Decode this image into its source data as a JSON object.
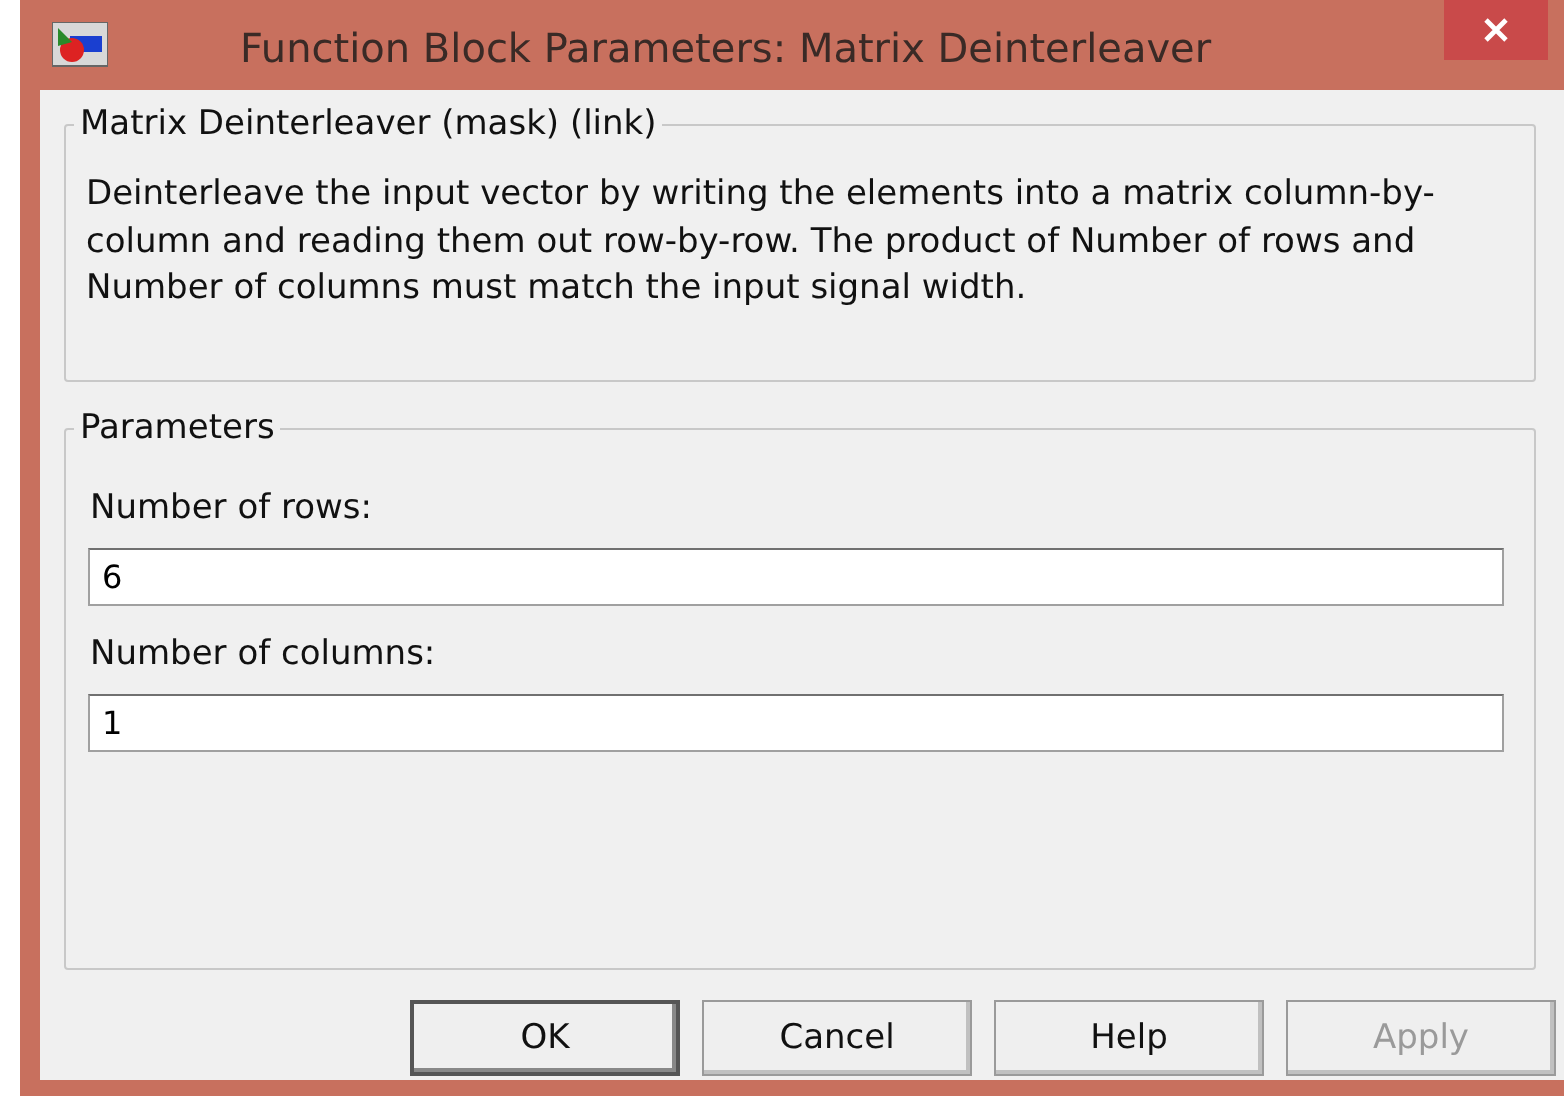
{
  "window": {
    "title": "Function Block Parameters: Matrix Deinterleaver"
  },
  "description_group": {
    "title": "Matrix Deinterleaver (mask) (link)",
    "text": "Deinterleave the input vector by writing the elements into a matrix column-by-column and reading them out row-by-row.  The product of Number of rows and Number of columns must match the input signal width."
  },
  "parameters_group": {
    "title": "Parameters",
    "fields": [
      {
        "label": "Number of rows:",
        "value": "6"
      },
      {
        "label": "Number of columns:",
        "value": "1"
      }
    ]
  },
  "buttons": [
    {
      "label": "OK",
      "disabled": false,
      "default": true
    },
    {
      "label": "Cancel",
      "disabled": false,
      "default": false
    },
    {
      "label": "Help",
      "disabled": false,
      "default": false
    },
    {
      "label": "Apply",
      "disabled": true,
      "default": false
    }
  ]
}
